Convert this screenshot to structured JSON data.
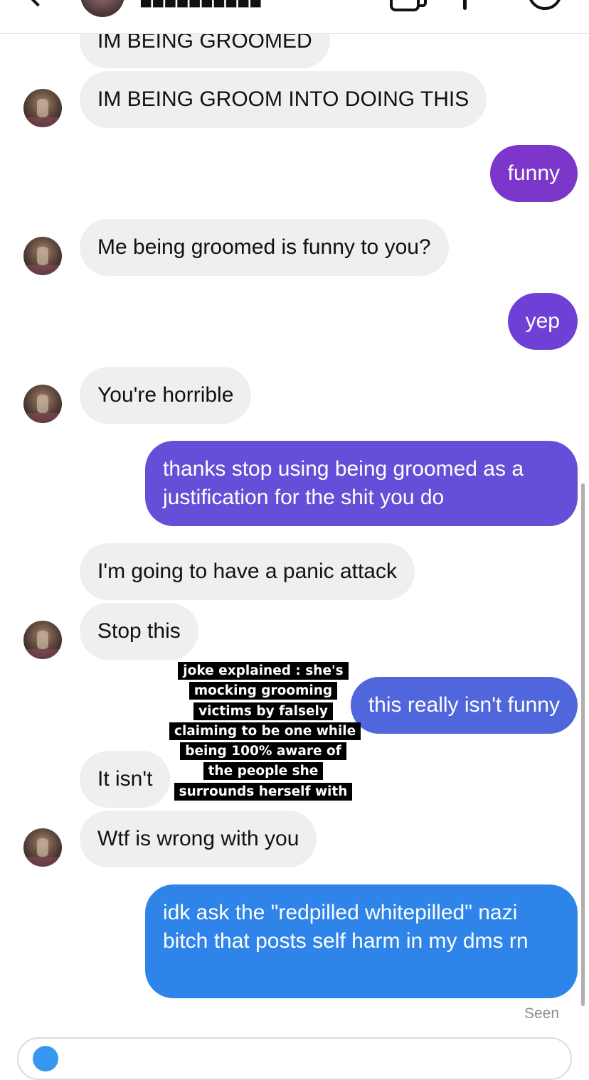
{
  "header": {
    "contact_name": "■■■■■■■■■■",
    "icons": [
      "back-arrow-icon",
      "contact-avatar",
      "video-call-icon",
      "more-icon",
      "info-icon"
    ]
  },
  "messages": [
    {
      "from": "them",
      "text": "IM BEING GROOMED"
    },
    {
      "from": "them",
      "text": "IM BEING GROOM INTO DOING THIS"
    },
    {
      "from": "me",
      "text": "funny"
    },
    {
      "from": "them",
      "text": "Me being groomed is funny to you?"
    },
    {
      "from": "me",
      "text": "yep"
    },
    {
      "from": "them",
      "text": "You're horrible"
    },
    {
      "from": "me",
      "text": "thanks stop using being groomed as a justification for the shit you do"
    },
    {
      "from": "them",
      "text": "I'm going to have a panic attack"
    },
    {
      "from": "them",
      "text": "Stop this"
    },
    {
      "from": "me",
      "text": "this really isn't funny"
    },
    {
      "from": "them",
      "text": "It isn't"
    },
    {
      "from": "them",
      "text": "Wtf is wrong with you"
    },
    {
      "from": "me",
      "text": "idk ask the \"redpilled whitepilled\" nazi bitch that posts self harm in my dms rn"
    }
  ],
  "caption": "joke explained : she's mocking grooming victims by falsely claiming to be one while being 100% aware of the people she surrounds herself with",
  "status": {
    "seen": "Seen"
  },
  "colors": {
    "received_bubble": "#efefef",
    "sent_gradient": [
      "#7b3ac9",
      "#6a45d8",
      "#4e65dd",
      "#2f84ea"
    ],
    "seen_text": "#8e8e8e"
  }
}
